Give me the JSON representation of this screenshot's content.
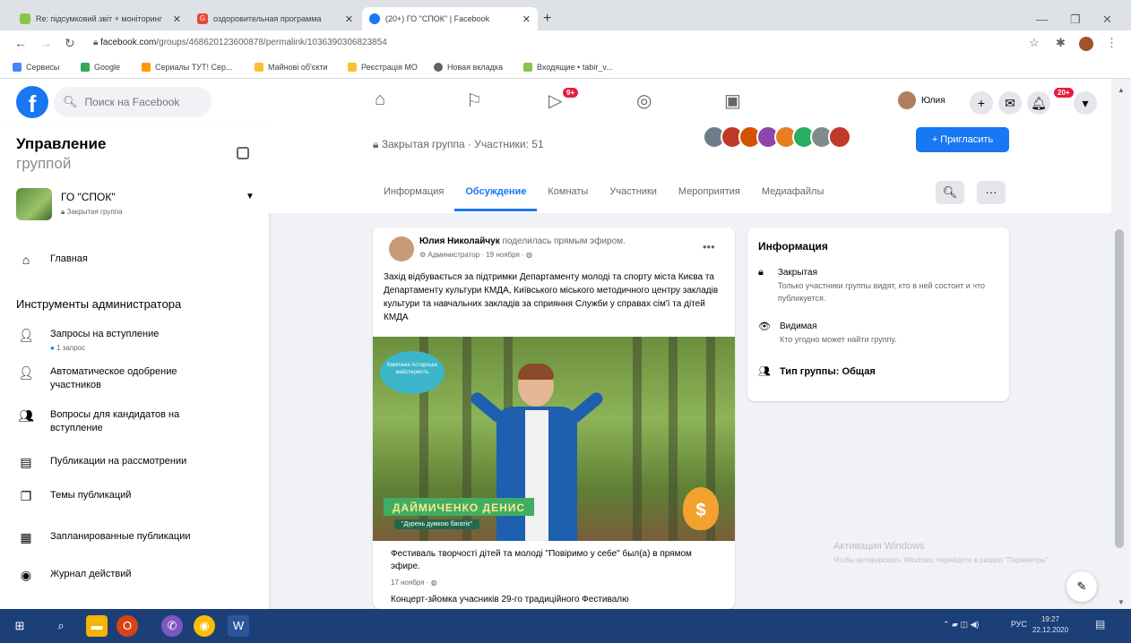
{
  "browser": {
    "tabs": [
      {
        "title": "Re: підсумковий звіт + моніторинг",
        "favicon_color": "#8bc34a",
        "active": false
      },
      {
        "title": "оздоровительная программа",
        "favicon_color": "#ea4335",
        "active": false
      },
      {
        "title": "(20+) ГО \"СПОК\" | Facebook",
        "favicon_color": "#1877f2",
        "active": true
      }
    ],
    "url_prefix": "facebook.com",
    "url_path": "/groups/468620123600878/permalink/1036390306823854",
    "bookmarks": [
      {
        "label": "Сервисы",
        "color": "#4285f4"
      },
      {
        "label": "Google",
        "color": "#34a853"
      },
      {
        "label": "Сериалы ТУТ! Сер...",
        "color": "#ff9800"
      },
      {
        "label": "Майнові об'єкти",
        "color": "#fbc02d"
      },
      {
        "label": "Реєстрація МО",
        "color": "#fbc02d"
      },
      {
        "label": "Новая вкладка",
        "color": "#5f6368"
      },
      {
        "label": "Входящие • tabir_v...",
        "color": "#8bc34a"
      }
    ]
  },
  "fb": {
    "search_placeholder": "Поиск на Facebook",
    "video_badge": "9+",
    "notif_badge": "20+",
    "user_name": "Юлия",
    "accent": "#1877f2",
    "badge_color": "#e41e3f"
  },
  "sidebar": {
    "title": "Управление",
    "title_sub": "группой",
    "group_name": "ГО \"СПОК\"",
    "group_type": "Закрытая группа",
    "home_label": "Главная",
    "tools_heading": "Инструменты администратора",
    "items": [
      {
        "label": "Запросы на вступление",
        "meta": "1 запрос",
        "icon": "user-add-icon"
      },
      {
        "label": "Автоматическое одобрение участников",
        "meta": "",
        "icon": "user-check-icon"
      },
      {
        "label": "Вопросы для кандидатов на вступление",
        "meta": "",
        "icon": "user-question-icon"
      },
      {
        "label": "Публикации на рассмотрении",
        "meta": "",
        "icon": "pending-posts-icon"
      },
      {
        "label": "Темы публикаций",
        "meta": "",
        "icon": "topics-icon"
      },
      {
        "label": "Запланированные публикации",
        "meta": "",
        "icon": "calendar-icon"
      },
      {
        "label": "Журнал действий",
        "meta": "",
        "icon": "activity-log-icon"
      }
    ]
  },
  "group": {
    "meta": "Закрытая группа · Участники: 51",
    "invite_label": "+ Пригласить",
    "tabs": [
      "Информация",
      "Обсуждение",
      "Комнаты",
      "Участники",
      "Мероприятия",
      "Медиафайлы"
    ],
    "active_tab": 1
  },
  "post": {
    "author": "Юлия Николайчук",
    "action": "поделилась прямым эфиром.",
    "meta": "Администратор · 19 ноября ·",
    "text": "Захід відбувається за підтримки Департаменту молоді та спорту міста Києва та Департаменту культури КМДА, Київського міського методичного центру закладів культури та навчальних закладів за сприяння Служби у справах сім'ї та дітей КМДА",
    "image_stamp": "Кампанія Астарська майстерність",
    "image_name": "ДАЙМИЧЕНКО ДЕНИС",
    "image_quote": "\"Дурень думкою багатіє\"",
    "caption": "Фестиваль творчості дітей та молоді \"Повіримо у себе\" был(а) в прямом эфире.",
    "caption_date": "17 ноября ·",
    "caption_more": "Концерт-зйомка учасників 29-го традиційного Фестивалю"
  },
  "info": {
    "heading": "Информация",
    "rows": [
      {
        "title": "Закрытая",
        "desc": "Только участники группы видят, кто в ней состоит и что публикуется.",
        "icon": "lock-icon"
      },
      {
        "title": "Видимая",
        "desc": "Кто угодно может найти группу.",
        "icon": "eye-icon"
      },
      {
        "title": "Тип группы: Общая",
        "desc": "",
        "icon": "group-type-icon"
      }
    ]
  },
  "system": {
    "watermark_title": "Активация Windows",
    "watermark_sub": "Чтобы активировать Windows, перейдите в раздел \"Параметры\".",
    "lang": "РУС",
    "time": "19:27",
    "date": "22.12.2020"
  }
}
